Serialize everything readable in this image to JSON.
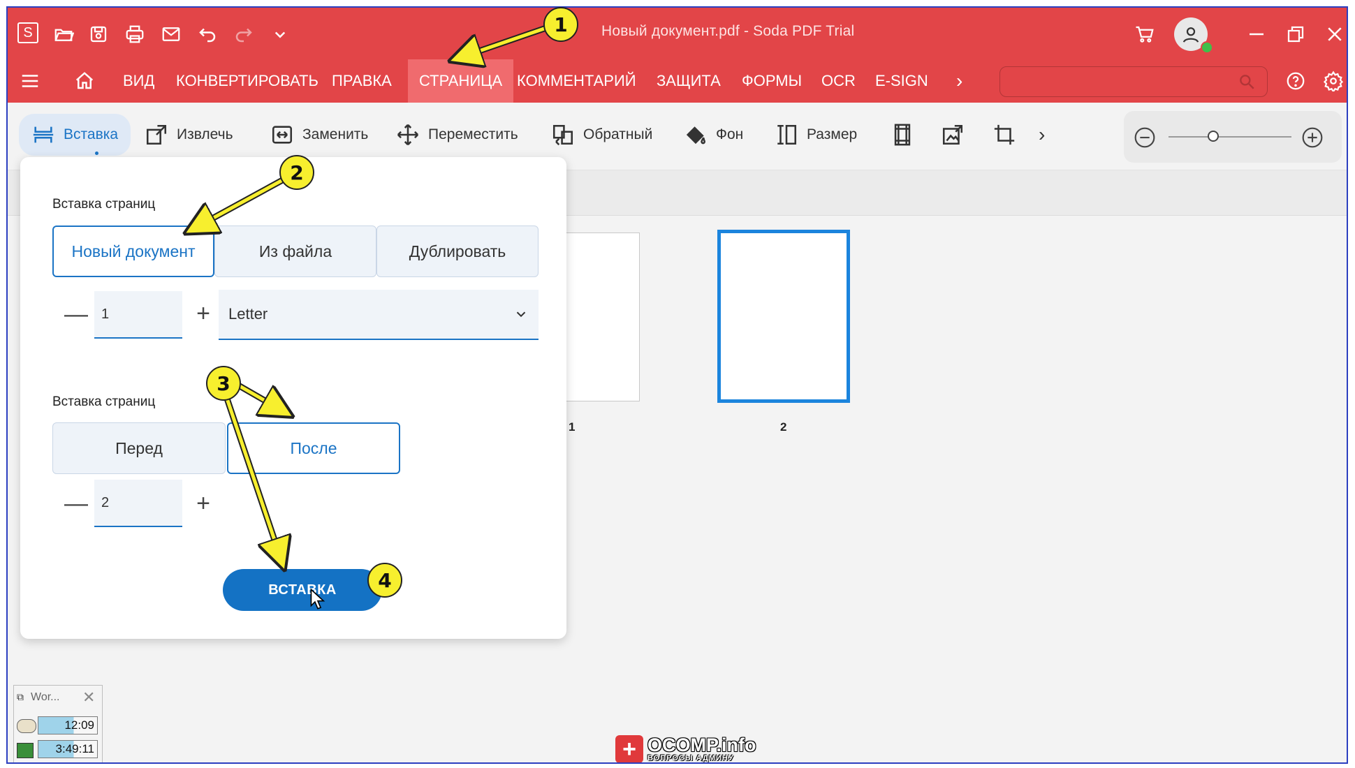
{
  "window": {
    "title": "Новый документ.pdf  -  Soda PDF Trial",
    "app_logo_letter": "S"
  },
  "quick_access": [
    "open-icon",
    "save-icon",
    "print-icon",
    "mail-icon",
    "undo-icon",
    "redo-icon",
    "chevron-down-icon"
  ],
  "menu": {
    "items": [
      {
        "label": "ВИД"
      },
      {
        "label": "КОНВЕРТИРОВАТЬ"
      },
      {
        "label": "ПРАВКА"
      },
      {
        "label": "СТРАНИЦА",
        "active": true
      },
      {
        "label": "КОММЕНТАРИЙ"
      },
      {
        "label": "ЗАЩИТА"
      },
      {
        "label": "ФОРМЫ"
      },
      {
        "label": "OCR"
      },
      {
        "label": "E-SIGN"
      }
    ],
    "more": "›"
  },
  "ribbon": {
    "insert": "Вставка",
    "extract": "Извлечь",
    "replace": "Заменить",
    "move": "Переместить",
    "reverse": "Обратный",
    "background": "Фон",
    "size": "Размер",
    "more": "›"
  },
  "panel": {
    "section1_label": "Вставка страниц",
    "source_options": [
      "Новый документ",
      "Из файла",
      "Дублировать"
    ],
    "selected_source": "Новый документ",
    "page_count": "1",
    "page_size": "Letter",
    "section2_label": "Вставка страниц",
    "position_options": [
      "Перед",
      "После"
    ],
    "selected_position": "После",
    "target_page": "2",
    "insert_button": "ВСТАВКА",
    "minus": "—",
    "plus": "+"
  },
  "pages": [
    {
      "number": "1"
    },
    {
      "number": "2",
      "selected": true
    }
  ],
  "annotations": [
    "1",
    "2",
    "3",
    "4"
  ],
  "mini_widget": {
    "title": "Wor...",
    "time1": "12:09",
    "time2": "3:49:11"
  },
  "watermark": {
    "text": "OCOMP.info",
    "sub": "ВОПРОСЫ АДМИНУ"
  },
  "colors": {
    "brand_red": "#e24548",
    "accent_blue": "#1b74c5",
    "annotation_yellow": "#f7ef2e"
  }
}
